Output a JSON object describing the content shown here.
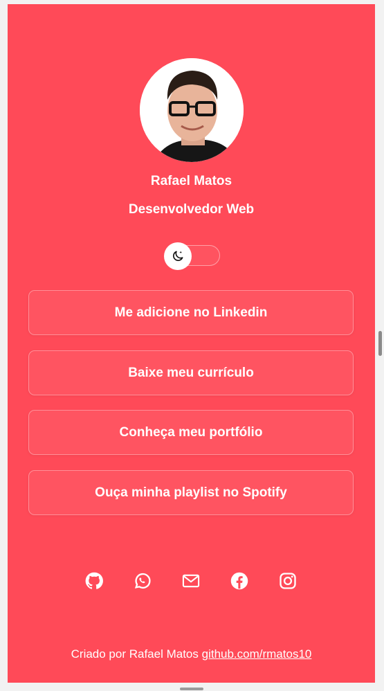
{
  "profile": {
    "name": "Rafael Matos",
    "role": "Desenvolvedor Web",
    "avatar_icon": "profile-photo"
  },
  "theme_toggle": {
    "icon": "moon-icon",
    "state": "off"
  },
  "links": [
    {
      "label": "Me adicione no Linkedin"
    },
    {
      "label": "Baixe meu currículo"
    },
    {
      "label": "Conheça meu portfólio"
    },
    {
      "label": "Ouça minha playlist no Spotify"
    }
  ],
  "socials": [
    {
      "icon": "github-icon"
    },
    {
      "icon": "whatsapp-icon"
    },
    {
      "icon": "mail-icon"
    },
    {
      "icon": "facebook-icon"
    },
    {
      "icon": "instagram-icon"
    }
  ],
  "footer": {
    "text": "Criado por Rafael Matos ",
    "link": "github.com/rmatos10"
  },
  "colors": {
    "background": "#ff4a58",
    "text": "#ffffff"
  }
}
